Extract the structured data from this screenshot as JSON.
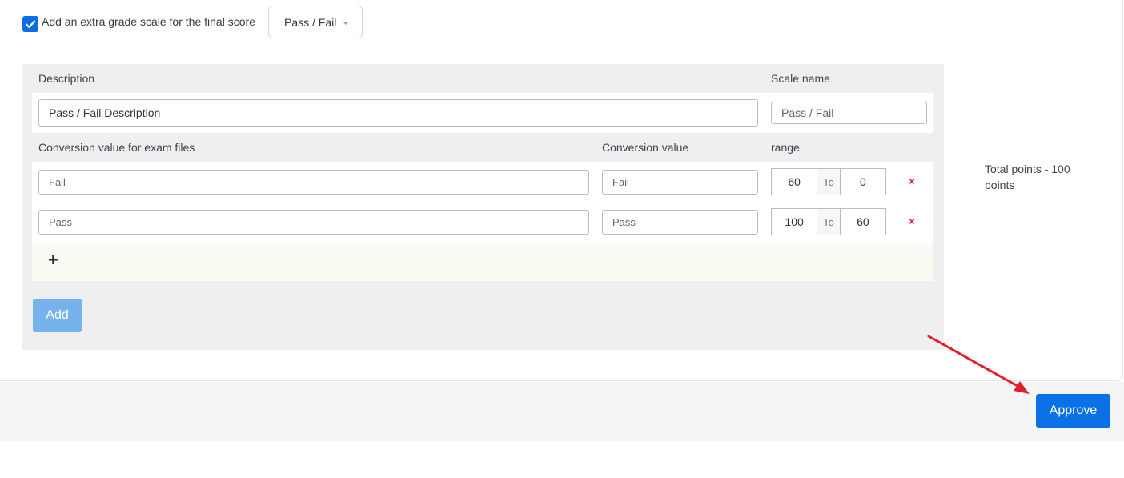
{
  "grade_option": {
    "checked": true,
    "label": "Add an extra grade scale for the final score",
    "selected_scale": "Pass / Fail"
  },
  "panel": {
    "description_label": "Description",
    "scale_name_label": "Scale name",
    "description_value": "Pass / Fail Description",
    "scale_name_value": "Pass / Fail",
    "col_conversion_files": "Conversion value for exam files",
    "col_conversion_value": "Conversion value",
    "col_range": "range",
    "rows": [
      {
        "file_value": "Fail",
        "conversion": "Fail",
        "from": "60",
        "to_label": "To",
        "to": "0"
      },
      {
        "file_value": "Pass",
        "conversion": "Pass",
        "from": "100",
        "to_label": "To",
        "to": "60"
      }
    ],
    "delete_symbol": "×",
    "plus_symbol": "+",
    "add_label": "Add"
  },
  "total_points": "Total points - 100 points",
  "approve_label": "Approve",
  "colors": {
    "primary": "#0a72e6",
    "add_button": "#76b3ec",
    "delete": "#e0202a",
    "annotation_arrow": "#e0202a"
  }
}
